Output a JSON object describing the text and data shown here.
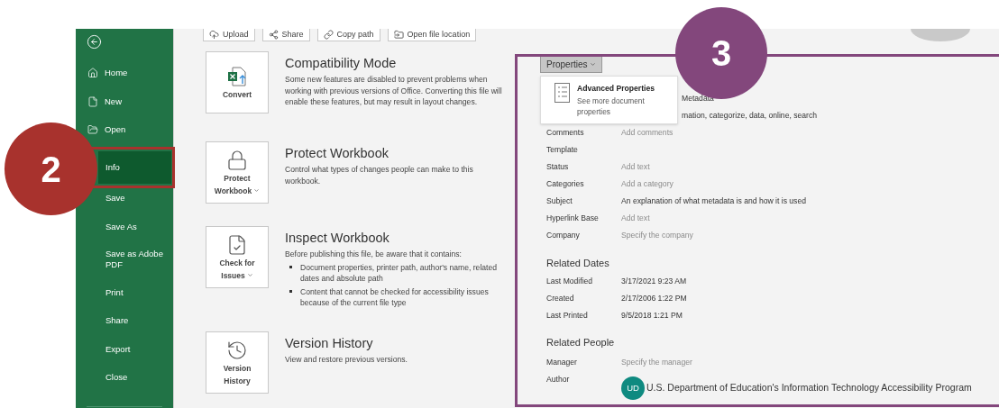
{
  "sidebar": {
    "items": [
      {
        "label": "Home",
        "selected": false
      },
      {
        "label": "New",
        "selected": false
      },
      {
        "label": "Open",
        "selected": false
      },
      {
        "label": "Info",
        "selected": true
      },
      {
        "label": "Save",
        "selected": false
      },
      {
        "label": "Save As",
        "selected": false
      },
      {
        "label": "Save as Adobe PDF",
        "selected": false
      },
      {
        "label": "Print",
        "selected": false
      },
      {
        "label": "Share",
        "selected": false
      },
      {
        "label": "Export",
        "selected": false
      },
      {
        "label": "Close",
        "selected": false
      }
    ]
  },
  "toolbar": [
    {
      "label": "Upload"
    },
    {
      "label": "Share"
    },
    {
      "label": "Copy path"
    },
    {
      "label": "Open file location"
    }
  ],
  "sections": [
    {
      "title": "Compatibility Mode",
      "button": [
        "Convert"
      ],
      "dropdown": false,
      "description": "Some new features are disabled to prevent problems when working with previous versions of Office. Converting this file will enable these features, but may result in layout changes."
    },
    {
      "title": "Protect Workbook",
      "button": [
        "Protect",
        "Workbook"
      ],
      "dropdown": true,
      "description": "Control what types of changes people can make to this workbook."
    },
    {
      "title": "Inspect Workbook",
      "button": [
        "Check for",
        "Issues"
      ],
      "dropdown": true,
      "description": "Before publishing this file, be aware that it contains:",
      "bullets": [
        "Document properties, printer path, author's name, related dates and absolute path",
        "Content that cannot be checked for accessibility issues because of the current file type"
      ]
    },
    {
      "title": "Version History",
      "button": [
        "Version",
        "History"
      ],
      "dropdown": false,
      "description": "View and restore previous versions."
    }
  ],
  "properties": {
    "button": "Properties",
    "menu": {
      "title": "Advanced Properties",
      "description": "See more document properties"
    },
    "rows": [
      {
        "value": "Metadata"
      },
      {
        "value": "mation, categorize, data, online, search"
      },
      {
        "label": "Comments",
        "value": "Add comments",
        "empty": true
      },
      {
        "label": "Template"
      },
      {
        "label": "Status",
        "value": "Add text",
        "empty": true
      },
      {
        "label": "Categories",
        "value": "Add a category",
        "empty": true
      },
      {
        "label": "Subject",
        "value": "An explanation of what metadata is and how it is used",
        "empty": false
      },
      {
        "label": "Hyperlink Base",
        "value": "Add text",
        "empty": true
      },
      {
        "label": "Company",
        "value": "Specify the company",
        "empty": true
      }
    ]
  },
  "related_dates": {
    "heading": "Related Dates",
    "rows": [
      {
        "label": "Last Modified",
        "value": "3/17/2021 9:23 AM"
      },
      {
        "label": "Created",
        "value": "2/17/2006 1:22 PM"
      },
      {
        "label": "Last Printed",
        "value": "9/5/2018 1:21 PM"
      }
    ]
  },
  "related_people": {
    "heading": "Related People",
    "manager": {
      "label": "Manager",
      "value": "Specify the manager",
      "empty": true
    },
    "author": {
      "label": "Author",
      "initials": "UD",
      "name": "U.S. Department of Education's Information Technology Accessibility Program"
    }
  },
  "annotations": [
    {
      "number": "2",
      "color": "#a8322d"
    },
    {
      "number": "3",
      "color": "#83477c"
    }
  ]
}
